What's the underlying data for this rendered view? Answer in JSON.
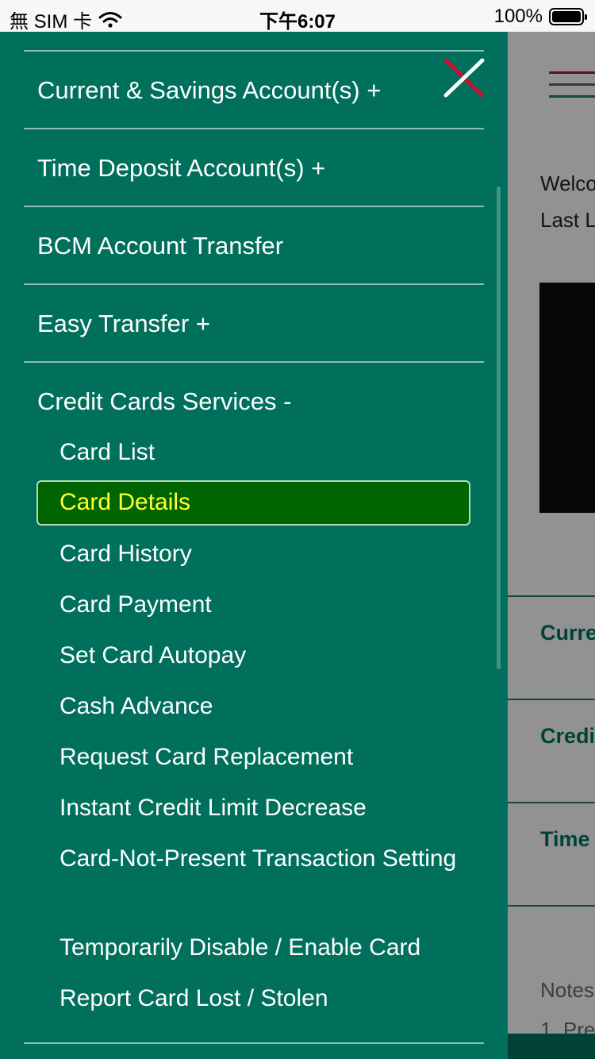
{
  "status_bar": {
    "carrier": "無 SIM 卡",
    "time": "下午6:07",
    "battery": "100%"
  },
  "drawer": {
    "menu": [
      {
        "label": "Current & Savings Account(s) +"
      },
      {
        "label": "Time Deposit Account(s) +"
      },
      {
        "label": "BCM Account Transfer"
      },
      {
        "label": "Easy Transfer +"
      },
      {
        "label": "Credit Cards Services -"
      }
    ],
    "credit_card_submenu": [
      {
        "label": "Card List"
      },
      {
        "label": "Card Details"
      },
      {
        "label": "Card History"
      },
      {
        "label": "Card Payment"
      },
      {
        "label": "Set Card Autopay"
      },
      {
        "label": "Cash Advance"
      },
      {
        "label": "Request Card Replacement"
      },
      {
        "label": "Instant Credit Limit Decrease"
      },
      {
        "label": "Card-Not-Present Transaction Setting"
      },
      {
        "label": "Temporarily Disable / Enable Card"
      },
      {
        "label": "Report Card Lost / Stolen"
      }
    ],
    "active_item": "Card Details"
  },
  "background": {
    "welcome": "Welco",
    "last_login": "Last L",
    "sections": [
      "Curre",
      "Credi",
      "Time"
    ],
    "notes": "Notes",
    "note_first": "1. Pre"
  },
  "colors": {
    "drawer_bg": "#00705c",
    "active_bg": "#006400",
    "active_text": "#ffff33",
    "close_red": "#c8102e"
  }
}
